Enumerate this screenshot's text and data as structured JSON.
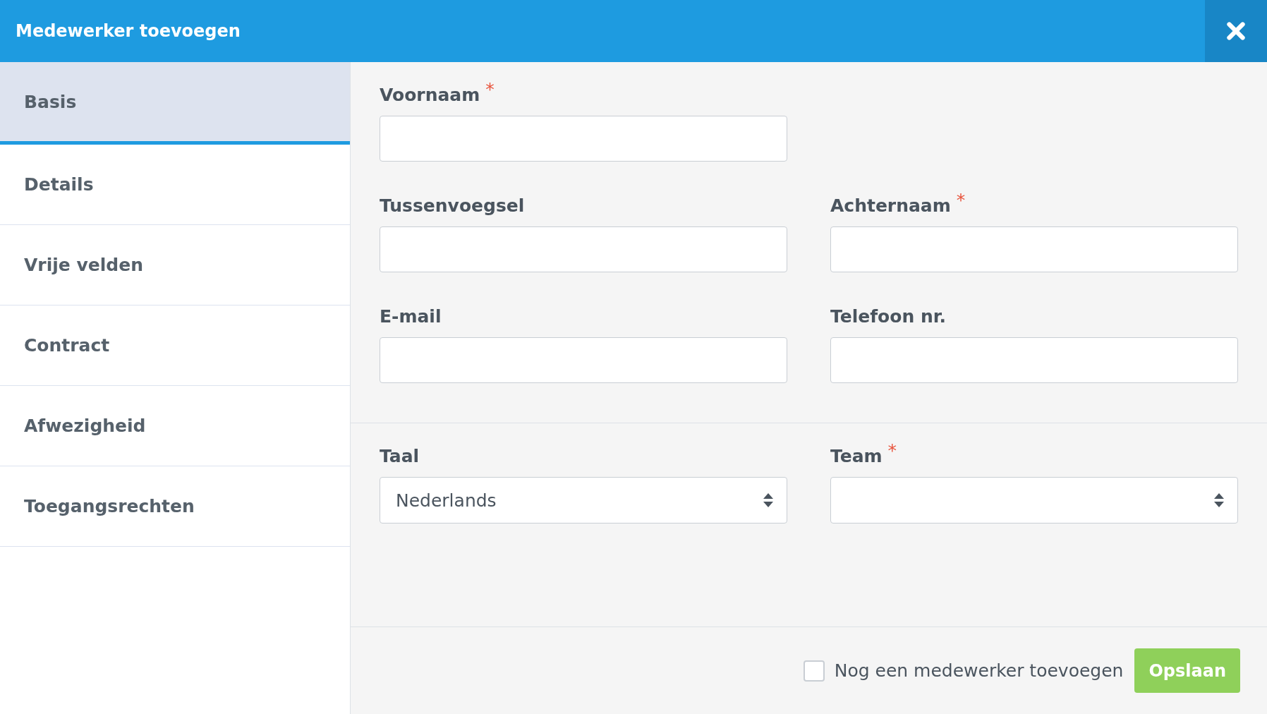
{
  "window": {
    "title": "Medewerker toevoegen"
  },
  "tabs": [
    {
      "label": "Basis",
      "selected": true
    },
    {
      "label": "Details",
      "selected": false
    },
    {
      "label": "Vrije velden",
      "selected": false
    },
    {
      "label": "Contract",
      "selected": false
    },
    {
      "label": "Afwezigheid",
      "selected": false
    },
    {
      "label": "Toegangsrechten",
      "selected": false
    }
  ],
  "sections": [
    {
      "rows": [
        [
          {
            "label": "Voornaam",
            "required_mark": "*",
            "kind": "text"
          }
        ],
        [
          {
            "label": "Tussenvoegsel",
            "kind": "text"
          },
          {
            "label": "Achternaam",
            "required_mark": "*",
            "kind": "text"
          }
        ],
        [
          {
            "label": "E-mail",
            "kind": "text"
          },
          {
            "label": "Telefoon nr.",
            "kind": "text"
          }
        ]
      ]
    },
    {
      "rows": [
        [
          {
            "label": "Taal",
            "kind": "select",
            "value": "Nederlands"
          },
          {
            "label": "Team",
            "required_mark": "*",
            "kind": "select"
          }
        ]
      ]
    }
  ],
  "footer": {
    "checkbox": {
      "label": "Nog een medewerker toevoegen",
      "checked": false
    },
    "button": "Opslaan"
  }
}
